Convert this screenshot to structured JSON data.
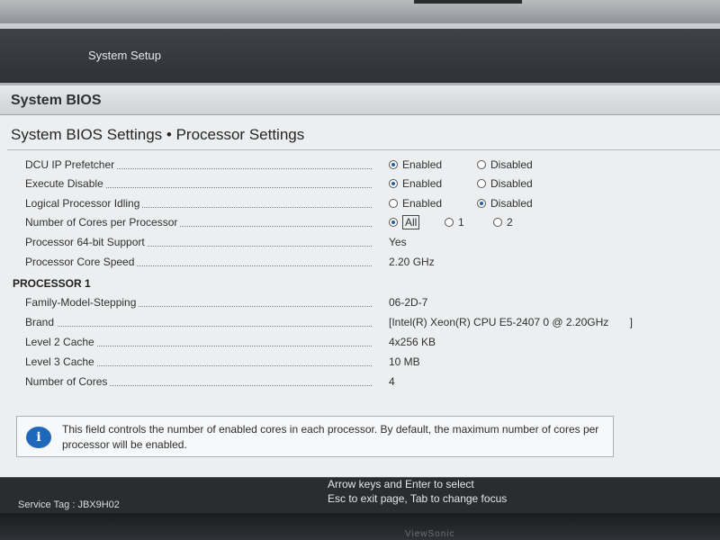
{
  "header": {
    "title": "System Setup"
  },
  "bios": {
    "title": "System BIOS",
    "page_title": "System BIOS Settings • Processor Settings"
  },
  "settings": [
    {
      "label": "DCU IP Prefetcher",
      "options": [
        "Enabled",
        "Disabled"
      ],
      "selected": "Enabled"
    },
    {
      "label": "Execute Disable",
      "options": [
        "Enabled",
        "Disabled"
      ],
      "selected": "Enabled"
    },
    {
      "label": "Logical Processor Idling",
      "options": [
        "Enabled",
        "Disabled"
      ],
      "selected": "Disabled"
    },
    {
      "label": "Number of Cores per Processor",
      "options": [
        "All",
        "1",
        "2"
      ],
      "selected": "All"
    },
    {
      "label": "Processor 64-bit Support",
      "value": "Yes"
    },
    {
      "label": "Processor Core Speed",
      "value": "2.20 GHz"
    }
  ],
  "processor1": {
    "heading": "PROCESSOR 1",
    "rows": [
      {
        "label": "Family-Model-Stepping",
        "value": "06-2D-7"
      },
      {
        "label": "Brand",
        "value": "[Intel(R) Xeon(R) CPU E5-2407 0 @ 2.20GHz       ]"
      },
      {
        "label": "Level 2 Cache",
        "value": "4x256 KB"
      },
      {
        "label": "Level 3 Cache",
        "value": "10 MB"
      },
      {
        "label": "Number of Cores",
        "value": "4"
      }
    ]
  },
  "help": {
    "icon": "info-icon",
    "text": "This field controls the number of enabled cores in each processor. By default, the maximum number of cores per processor will be enabled."
  },
  "footer": {
    "service_tag": "Service Tag : JBX9H02",
    "hint_line1": "Arrow keys and Enter to select",
    "hint_line2": "Esc to exit page, Tab to change focus"
  },
  "monitor": {
    "brand": "ViewSonic"
  }
}
